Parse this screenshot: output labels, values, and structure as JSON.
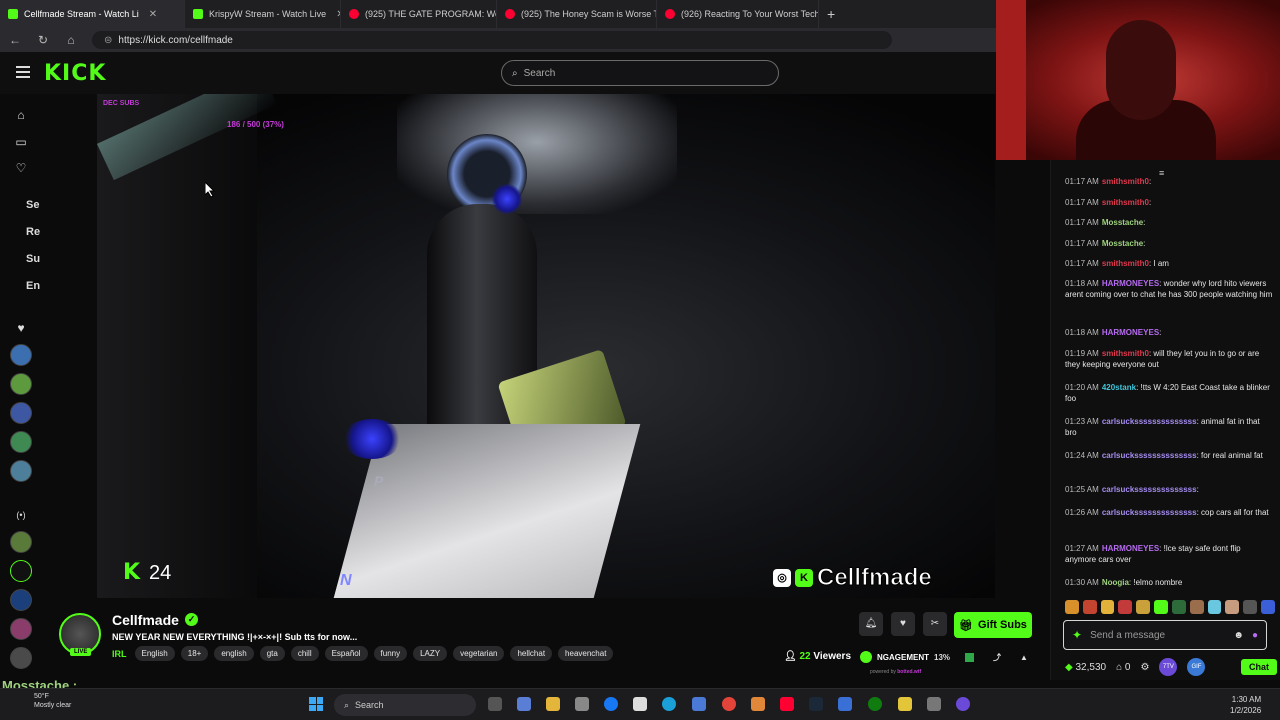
{
  "browser": {
    "tabs": [
      {
        "label": "Cellfmade Stream - Watch Li",
        "active": true,
        "color": "#53fc18"
      },
      {
        "label": "KrispyW Stream - Watch Live",
        "active": false,
        "color": "#53fc18"
      },
      {
        "label": "(925) THE GATE PROGRAM: Were",
        "active": false,
        "color": "#ff0033"
      },
      {
        "label": "(925) The Honey Scam is Worse T",
        "active": false,
        "color": "#ff0033"
      },
      {
        "label": "(926) Reacting To Your Worst Tech",
        "active": false,
        "color": "#ff0033"
      }
    ],
    "new_tab": "+",
    "url": "https://kick.com/cellfmade"
  },
  "header": {
    "logo": "KICK",
    "search_placeholder": "Search"
  },
  "leftnav": {
    "items": [
      "Se",
      "Re",
      "Su",
      "En"
    ]
  },
  "video": {
    "sub_text": "DEC SUBS",
    "goal_text": "186 / 500 (37%)",
    "kick_count": "24",
    "gear_n": "N",
    "gear_p": "P",
    "brand_name": "Cellfmade"
  },
  "chat": {
    "messages": [
      {
        "time": "01:17 AM",
        "user": "smithsmith0",
        "color": "#e0394d",
        "text": ""
      },
      {
        "time": "01:17 AM",
        "user": "smithsmith0",
        "color": "#e0394d",
        "text": ""
      },
      {
        "time": "01:17 AM",
        "user": "Mosstache",
        "color": "#9fd27f",
        "text": ""
      },
      {
        "time": "01:17 AM",
        "user": "Mosstache",
        "color": "#9fd27f",
        "text": ""
      },
      {
        "time": "01:17 AM",
        "user": "smithsmith0",
        "color": "#e0394d",
        "text": "I am"
      },
      {
        "time": "01:18 AM",
        "user": "HARMONEYES",
        "color": "#b66cf0",
        "text": "wonder why lord hito viewers arent coming over to chat he has 300 people watching him"
      },
      {
        "time": "01:18 AM",
        "user": "HARMONEYES",
        "color": "#b66cf0",
        "text": ""
      },
      {
        "time": "01:19 AM",
        "user": "smithsmith0",
        "color": "#e0394d",
        "text": "will they let you in to go or are they keeping everyone out"
      },
      {
        "time": "01:20 AM",
        "user": "420stank",
        "color": "#40c6d9",
        "text": "!tts W 4:20 East Coast take a blinker foo"
      },
      {
        "time": "01:23 AM",
        "user": "carlsuckssssssssssssss",
        "color": "#a58cf0",
        "text": "animal fat in that bro"
      },
      {
        "time": "01:24 AM",
        "user": "carlsuckssssssssssssss",
        "color": "#a58cf0",
        "text": "for real animal fat"
      },
      {
        "time": "01:25 AM",
        "user": "carlsuckssssssssssssss",
        "color": "#a58cf0",
        "text": ""
      },
      {
        "time": "01:26 AM",
        "user": "carlsuckssssssssssssss",
        "color": "#a58cf0",
        "text": "cop cars all for that"
      },
      {
        "time": "01:27 AM",
        "user": "HARMONEYES",
        "color": "#b66cf0",
        "text": "!lce stay safe dont flip anymore cars over"
      },
      {
        "time": "01:30 AM",
        "user": "Noogia",
        "color": "#9fd27f",
        "text": "!elmo nombre"
      }
    ],
    "input_placeholder": "Send a message",
    "points": "32,530",
    "zero": "0",
    "send_label": "Chat"
  },
  "stream": {
    "name": "Cellfmade",
    "live_label": "LIVE",
    "title": "NEW YEAR NEW EVERYTHING !|+×-×+|! Sub tts for now...",
    "category": "IRL",
    "tags": [
      "English",
      "18+",
      "english",
      "gta",
      "chill",
      "Español",
      "funny",
      "LAZY",
      "vegetarian",
      "hellchat",
      "heavenchat"
    ],
    "gift_label": "Gift Subs",
    "viewers_count": "22",
    "viewers_label": "Viewers",
    "engagement_label": "NGAGEMENT",
    "engagement_pct": "13%",
    "powered_by": "powered by",
    "powered_brand": "botted.wtf"
  },
  "overlay_name": "Mosstache :",
  "taskbar": {
    "temp": "50°F",
    "weather": "Mostly clear",
    "search_label": "Search",
    "time": "1:30 AM",
    "date": "1/2/2026"
  }
}
